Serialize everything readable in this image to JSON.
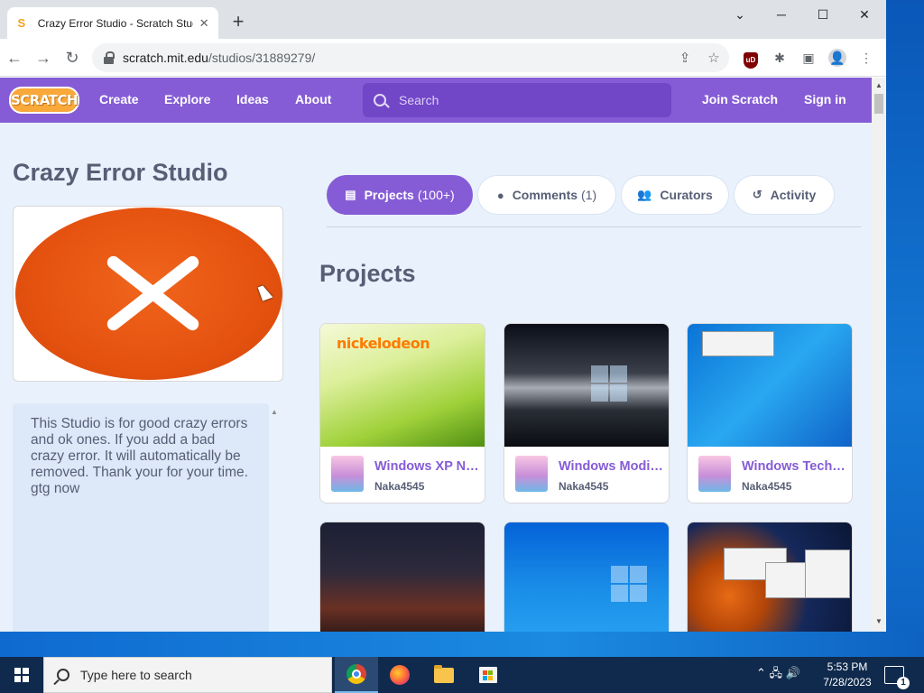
{
  "browser": {
    "tab_title": "Crazy Error Studio - Scratch Studio",
    "tab_favicon": "S",
    "tab_close": "✕",
    "new_tab": "+",
    "minimize": "─",
    "maximize": "☐",
    "close": "✕",
    "chevron": "⌄",
    "url_host": "scratch.mit.edu",
    "url_path": "/studios/31889279/",
    "extension_badge": "uD"
  },
  "scratch_nav": {
    "logo": "SCRATCH",
    "create": "Create",
    "explore": "Explore",
    "ideas": "Ideas",
    "about": "About",
    "search_placeholder": "Search",
    "join": "Join Scratch",
    "sign_in": "Sign in"
  },
  "studio": {
    "title": "Crazy Error Studio",
    "description": "This Studio is for good crazy errors and ok ones. If you add a bad crazy error. It will automatically be removed. Thank your for your time. gtg now"
  },
  "tabs": [
    {
      "label": "Projects",
      "count": "(100+)",
      "icon": "▤",
      "active": true
    },
    {
      "label": "Comments",
      "count": "(1)",
      "icon": "●",
      "active": false
    },
    {
      "label": "Curators",
      "count": "",
      "icon": "👥",
      "active": false
    },
    {
      "label": "Activity",
      "count": "",
      "icon": "↺",
      "active": false
    }
  ],
  "projects_heading": "Projects",
  "projects": [
    {
      "title": "Windows XP Nickelodeon",
      "author": "Naka4545",
      "image_label": "nickelodeon"
    },
    {
      "title": "Windows Modified",
      "author": "Naka4545"
    },
    {
      "title": "Windows Technical",
      "author": "Naka4545"
    },
    {
      "title": "",
      "author": ""
    },
    {
      "title": "",
      "author": ""
    },
    {
      "title": "",
      "author": ""
    }
  ],
  "taskbar": {
    "search_placeholder": "Type here to search",
    "time": "5:53 PM",
    "date": "7/28/2023",
    "notification_count": "1",
    "tray_icons": "⌃  🖧  🔊"
  },
  "colors": {
    "scratch_purple": "#855cd6",
    "scratch_text": "#575e75",
    "page_bg": "#e9f1fc",
    "error_orange": "#e55210"
  }
}
